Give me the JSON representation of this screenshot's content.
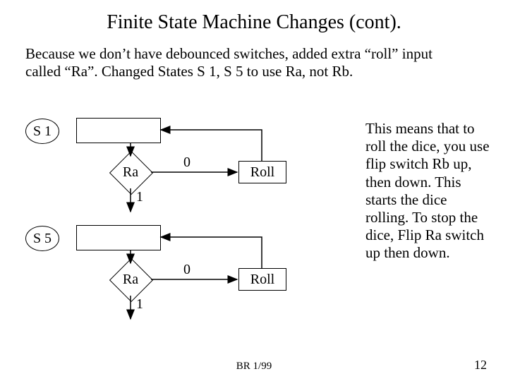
{
  "title": "Finite State Machine Changes (cont).",
  "intro": "Because we don’t have debounced switches, added extra “roll” input called “Ra”.  Changed States S 1, S 5 to use Ra, not Rb.",
  "side_text": "This means that to roll the dice, you use flip switch Rb up, then down. This starts the dice rolling. To stop the dice, Flip Ra switch up then down.",
  "states": {
    "s1": "S 1",
    "s5": "S 5"
  },
  "diamond": {
    "label": "Ra",
    "exit0": "0",
    "exit1": "1"
  },
  "roll": "Roll",
  "footer": {
    "center": "BR 1/99",
    "page": "12"
  }
}
